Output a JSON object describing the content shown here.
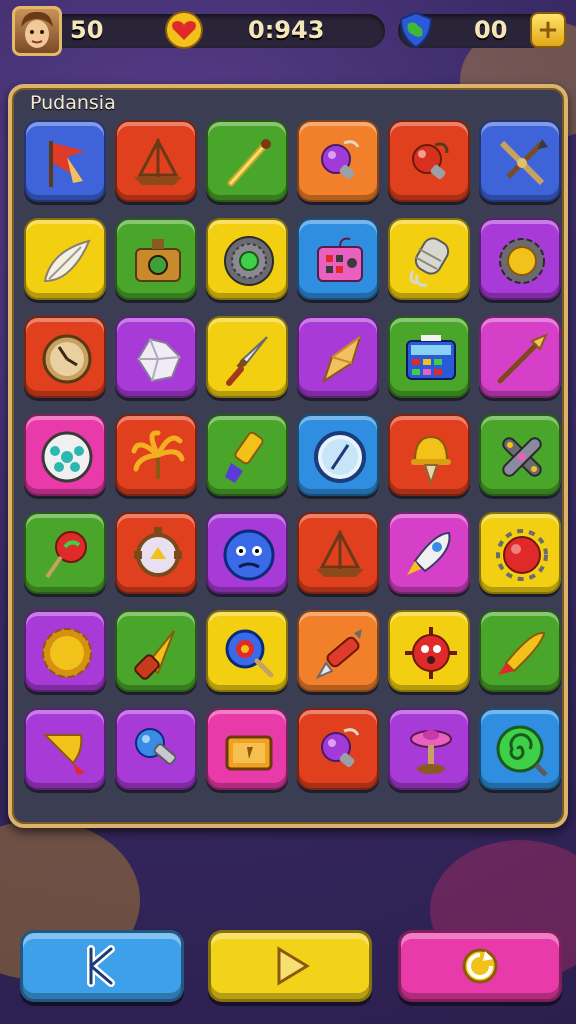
{
  "hud": {
    "lives": "50",
    "timer": "0:943",
    "gems": "00",
    "plus_label": "+"
  },
  "board": {
    "title": "Pudansia",
    "rows": [
      [
        {
          "color": "#3f63d8",
          "icon": "flag-icon"
        },
        {
          "color": "#e0401e",
          "icon": "sailboat-icon"
        },
        {
          "color": "#4aa62a",
          "icon": "wand-icon"
        },
        {
          "color": "#f27f2a",
          "icon": "potion-icon"
        },
        {
          "color": "#e0401e",
          "icon": "bomb-icon"
        },
        {
          "color": "#3f63d8",
          "icon": "arrows-icon"
        }
      ],
      [
        {
          "color": "#f3cf12",
          "icon": "leaf-icon"
        },
        {
          "color": "#4aa62a",
          "icon": "camera-icon"
        },
        {
          "color": "#f3cf12",
          "icon": "gem-ring-icon"
        },
        {
          "color": "#2f8ee0",
          "icon": "radio-icon"
        },
        {
          "color": "#f3cf12",
          "icon": "rope-icon"
        },
        {
          "color": "#a83ad8",
          "icon": "gear-icon"
        }
      ],
      [
        {
          "color": "#e0401e",
          "icon": "compass-icon"
        },
        {
          "color": "#a83ad8",
          "icon": "crystal-icon"
        },
        {
          "color": "#f3cf12",
          "icon": "dagger-icon"
        },
        {
          "color": "#a83ad8",
          "icon": "crystal-shard-icon"
        },
        {
          "color": "#4aa62a",
          "icon": "calculator-icon"
        },
        {
          "color": "#d640c8",
          "icon": "spear-icon"
        }
      ],
      [
        {
          "color": "#e83aa8",
          "icon": "orb-icon"
        },
        {
          "color": "#e0401e",
          "icon": "palm-icon"
        },
        {
          "color": "#4aa62a",
          "icon": "brush-icon"
        },
        {
          "color": "#2f8ee0",
          "icon": "clock-icon"
        },
        {
          "color": "#e0401e",
          "icon": "bell-icon"
        },
        {
          "color": "#4aa62a",
          "icon": "bandage-icon"
        }
      ],
      [
        {
          "color": "#4aa62a",
          "icon": "key-icon"
        },
        {
          "color": "#e0401e",
          "icon": "shield-icon"
        },
        {
          "color": "#a83ad8",
          "icon": "face-icon"
        },
        {
          "color": "#e0401e",
          "icon": "sailboat-icon"
        },
        {
          "color": "#d640c8",
          "icon": "rocket-icon"
        },
        {
          "color": "#f3cf12",
          "icon": "mine-icon"
        }
      ],
      [
        {
          "color": "#a83ad8",
          "icon": "sun-icon"
        },
        {
          "color": "#4aa62a",
          "icon": "drum-icon"
        },
        {
          "color": "#f3cf12",
          "icon": "magnifier-icon"
        },
        {
          "color": "#f27f2a",
          "icon": "pen-icon"
        },
        {
          "color": "#f3cf12",
          "icon": "virus-icon"
        },
        {
          "color": "#4aa62a",
          "icon": "carrot-icon"
        }
      ],
      [
        {
          "color": "#a83ad8",
          "icon": "cone-icon"
        },
        {
          "color": "#a83ad8",
          "icon": "lamp-icon"
        },
        {
          "color": "#e83aa8",
          "icon": "chest-icon"
        },
        {
          "color": "#e0401e",
          "icon": "potion-icon"
        },
        {
          "color": "#a83ad8",
          "icon": "spinner-icon"
        },
        {
          "color": "#2f8ee0",
          "icon": "swirl-icon"
        }
      ]
    ]
  },
  "controls": [
    {
      "name": "back-button",
      "color": "#3fa0ea",
      "icon": "back-icon"
    },
    {
      "name": "play-button",
      "color": "#f3d21a",
      "icon": "play-icon"
    },
    {
      "name": "restart-button",
      "color": "#e83aa8",
      "icon": "restart-icon"
    }
  ]
}
